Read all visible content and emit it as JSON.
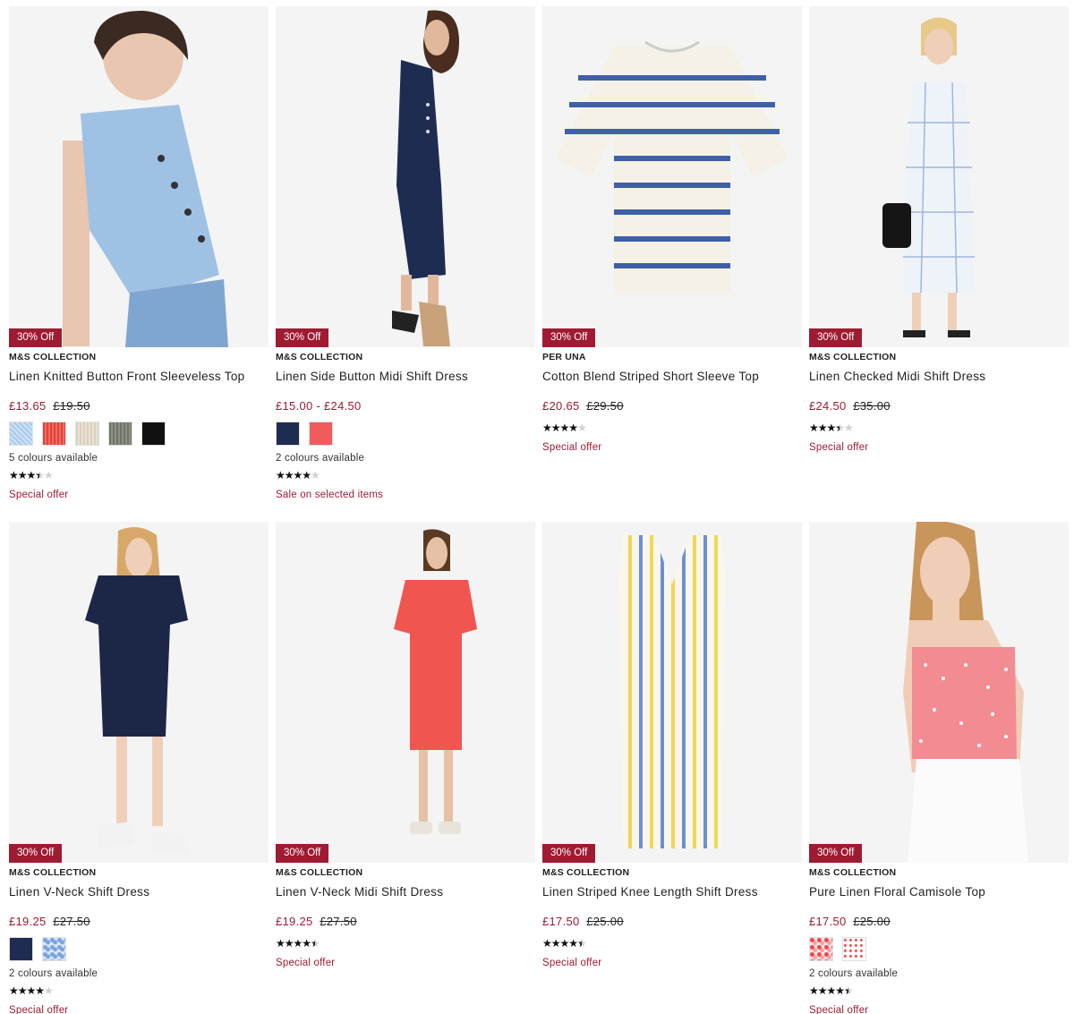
{
  "products": [
    {
      "badge": "30% Off",
      "brand": "M&S COLLECTION",
      "title": "Linen Knitted Button Front Sleeveless Top",
      "price_now": "£13.65",
      "price_was": "£19.50",
      "swatches": [
        "lightblue",
        "red",
        "beige",
        "khaki",
        "black"
      ],
      "colours_text": "5 colours available",
      "rating": 3.5,
      "offer": "Special offer"
    },
    {
      "badge": "30% Off",
      "brand": "M&S COLLECTION",
      "title": "Linen Side Button Midi Shift Dress",
      "price_now": "£15.00 - £24.50",
      "price_was": "",
      "swatches": [
        "navy",
        "coral"
      ],
      "colours_text": "2 colours available",
      "rating": 4.0,
      "offer": "Sale on selected items"
    },
    {
      "badge": "30% Off",
      "brand": "PER UNA",
      "title": "Cotton Blend Striped Short Sleeve Top",
      "price_now": "£20.65",
      "price_was": "£29.50",
      "swatches": [],
      "colours_text": "",
      "rating": 4.0,
      "offer": "Special offer"
    },
    {
      "badge": "30% Off",
      "brand": "M&S COLLECTION",
      "title": "Linen Checked Midi Shift Dress",
      "price_now": "£24.50",
      "price_was": "£35.00",
      "swatches": [],
      "colours_text": "",
      "rating": 3.5,
      "offer": "Special offer"
    },
    {
      "badge": "30% Off",
      "brand": "M&S COLLECTION",
      "title": "Linen V-Neck Shift Dress",
      "price_now": "£19.25",
      "price_was": "£27.50",
      "swatches": [
        "navy",
        "bluefloral"
      ],
      "colours_text": "2 colours available",
      "rating": 4.0,
      "offer": "Special offer"
    },
    {
      "badge": "30% Off",
      "brand": "M&S COLLECTION",
      "title": "Linen V-Neck Midi Shift Dress",
      "price_now": "£19.25",
      "price_was": "£27.50",
      "swatches": [],
      "colours_text": "",
      "rating": 4.5,
      "offer": "Special offer"
    },
    {
      "badge": "30% Off",
      "brand": "M&S COLLECTION",
      "title": "Linen Striped Knee Length Shift Dress",
      "price_now": "£17.50",
      "price_was": "£25.00",
      "swatches": [],
      "colours_text": "",
      "rating": 4.5,
      "offer": "Special offer"
    },
    {
      "badge": "30% Off",
      "brand": "M&S COLLECTION",
      "title": "Pure Linen Floral Camisole Top",
      "price_now": "£17.50",
      "price_was": "£25.00",
      "swatches": [
        "pinkfloral",
        "pinkfloral2"
      ],
      "colours_text": "2 colours available",
      "rating": 4.5,
      "offer": "Special offer"
    }
  ],
  "star_glyphs": "★★★★★",
  "colors": {
    "accent": "#9e1b32",
    "badge_bg": "#9e1b32"
  }
}
